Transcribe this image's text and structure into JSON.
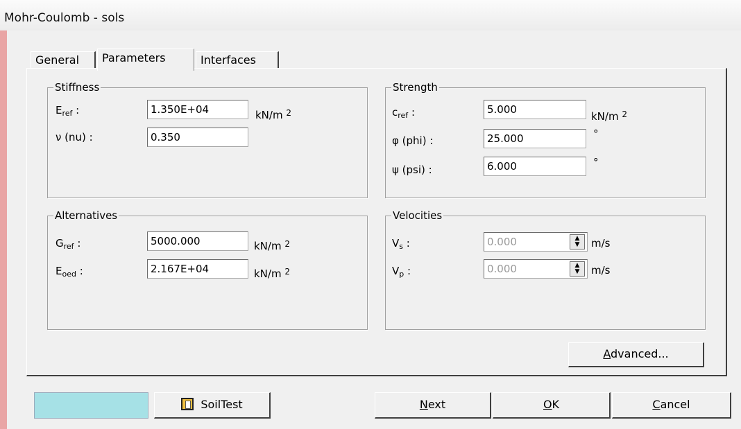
{
  "window": {
    "title": "Mohr-Coulomb - sols"
  },
  "tabs": [
    {
      "label": "General"
    },
    {
      "label": "Parameters"
    },
    {
      "label": "Interfaces"
    }
  ],
  "stiffness": {
    "title": "Stiffness",
    "eref_label_main": "E",
    "eref_label_sub": "ref",
    "eref_value": "1.350E+04",
    "eref_unit_main": "kN/m",
    "eref_unit_sup": "2",
    "nu_label": "ν (nu) :",
    "nu_value": "0.350"
  },
  "strength": {
    "title": "Strength",
    "cref_label_main": "c",
    "cref_label_sub": "ref",
    "cref_value": "5.000",
    "cref_unit_main": "kN/m",
    "cref_unit_sup": "2",
    "phi_label": "φ (phi) :",
    "phi_value": "25.000",
    "phi_unit": "°",
    "psi_label": "ψ (psi) :",
    "psi_value": "6.000",
    "psi_unit": "°"
  },
  "alternatives": {
    "title": "Alternatives",
    "gref_label_main": "G",
    "gref_label_sub": "ref",
    "gref_value": "5000.000",
    "gref_unit_main": "kN/m",
    "gref_unit_sup": "2",
    "eoed_label_main": "E",
    "eoed_label_sub": "oed",
    "eoed_value": "2.167E+04",
    "eoed_unit_main": "kN/m",
    "eoed_unit_sup": "2"
  },
  "velocities": {
    "title": "Velocities",
    "vs_label_main": "V",
    "vs_label_sub": "s",
    "vs_value": "0.000",
    "vs_unit": "m/s",
    "vp_label_main": "V",
    "vp_label_sub": "p",
    "vp_value": "0.000",
    "vp_unit": "m/s"
  },
  "buttons": {
    "advanced_underlined": "A",
    "advanced_rest": "dvanced...",
    "soiltest": "SoilTest",
    "next_underlined": "N",
    "next_rest": "ext",
    "ok_underlined": "O",
    "ok_rest": "K",
    "cancel_underlined": "C",
    "cancel_rest": "ancel"
  },
  "colors": {
    "material_color": "#a6e1e6",
    "left_strip": "#e9a5a5"
  }
}
